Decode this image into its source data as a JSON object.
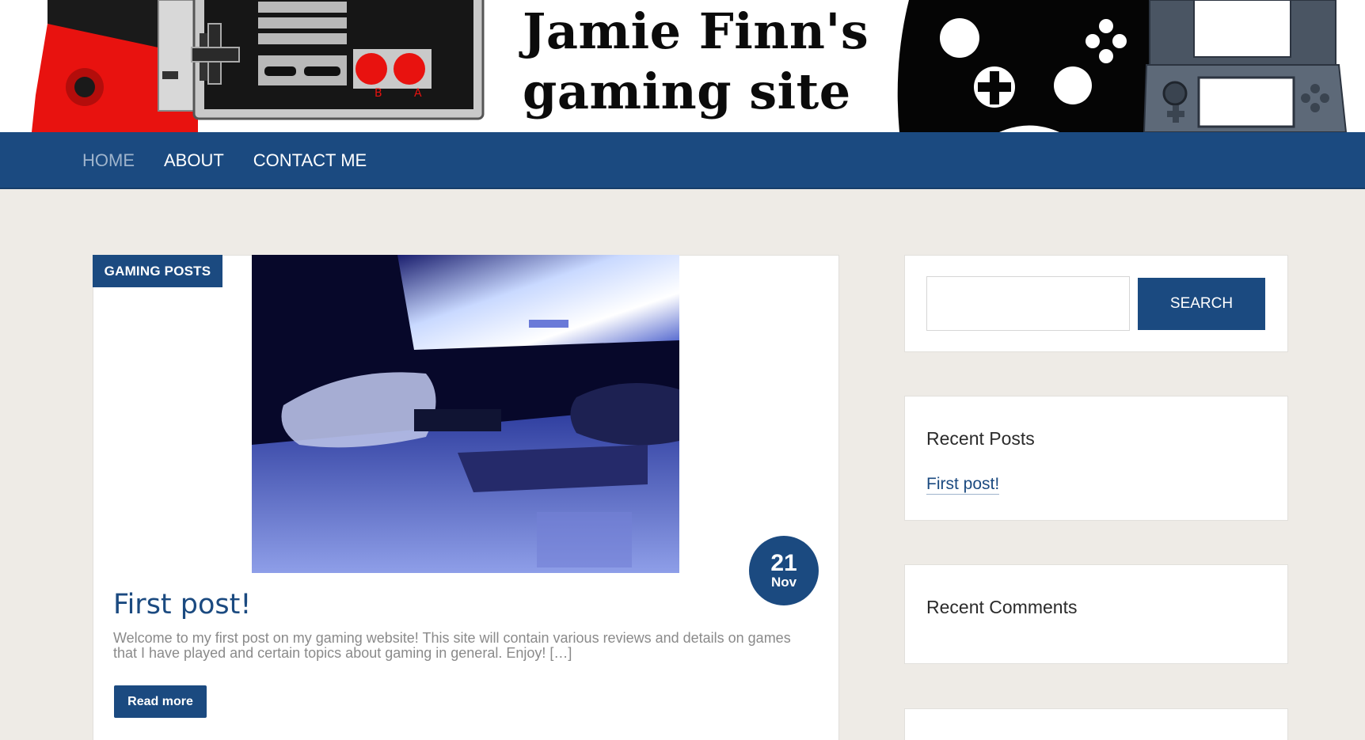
{
  "header": {
    "site_title_line1": "Jamie Finn's",
    "site_title_line2": "gaming site"
  },
  "nav": {
    "items": [
      {
        "label": "HOME",
        "active": true
      },
      {
        "label": "ABOUT",
        "active": false
      },
      {
        "label": "CONTACT ME",
        "active": false
      }
    ]
  },
  "post": {
    "category": "GAMING POSTS",
    "date_day": "21",
    "date_month": "Nov",
    "title": "First post!",
    "excerpt": "Welcome to my first post on my gaming website! This site will contain  various reviews and details on games that I have played and certain topics about gaming in general. Enjoy! […]",
    "read_more_label": "Read more"
  },
  "sidebar": {
    "search_button_label": "SEARCH",
    "search_placeholder": "",
    "recent_posts_title": "Recent Posts",
    "recent_posts": [
      "First post!"
    ],
    "recent_comments_title": "Recent Comments"
  },
  "colors": {
    "primary": "#1b4a80",
    "page_background": "#eeebe6",
    "nav_active": "#9fb4cc"
  }
}
